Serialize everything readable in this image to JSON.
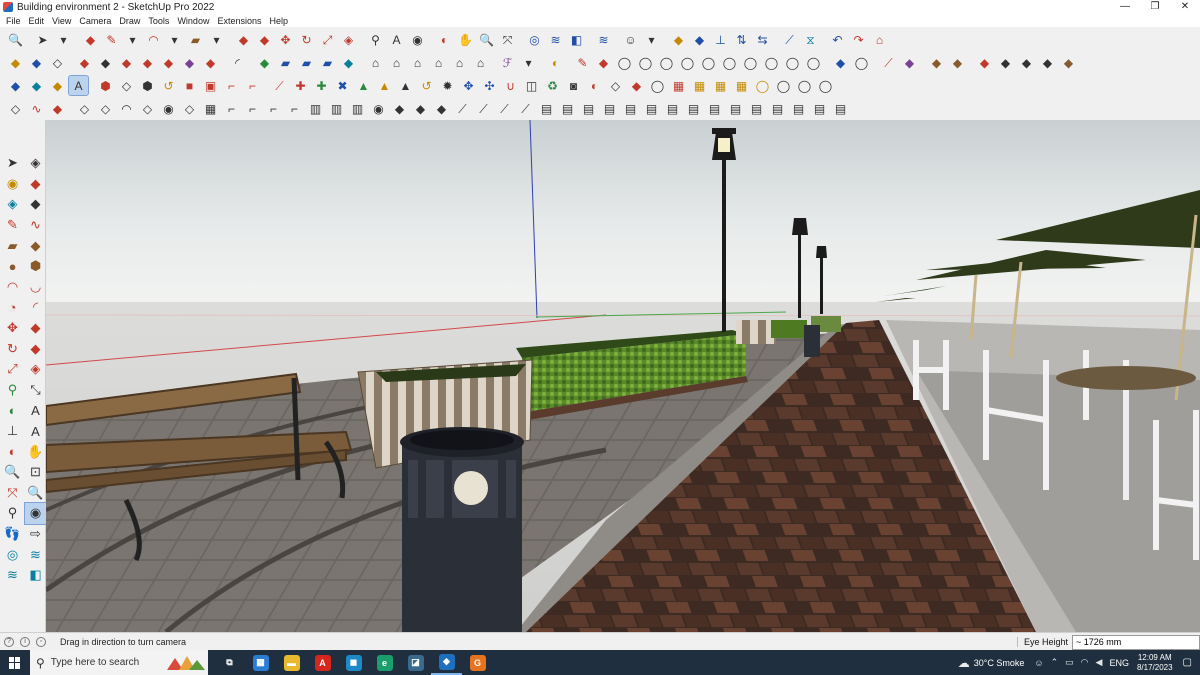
{
  "window": {
    "title": "Building environment 2 - SketchUp Pro 2022",
    "controls": [
      "—",
      "❐",
      "✕"
    ]
  },
  "menu": [
    "File",
    "Edit",
    "View",
    "Camera",
    "Draw",
    "Tools",
    "Window",
    "Extensions",
    "Help"
  ],
  "toolbars": {
    "row1": [
      {
        "icon": "zoom-icon",
        "g": "🔍",
        "c": "c3"
      },
      {
        "icon": "select-icon",
        "g": "➤",
        "c": "c3",
        "sep": true
      },
      {
        "icon": "dropdown-icon",
        "g": "▾",
        "c": "c3"
      },
      {
        "icon": "eraser-icon",
        "g": "◆",
        "c": "c1",
        "sep": true
      },
      {
        "icon": "pencil-icon",
        "g": "✎",
        "c": "c1"
      },
      {
        "icon": "dropdown-icon",
        "g": "▾",
        "c": "c3"
      },
      {
        "icon": "arc-icon",
        "g": "◠",
        "c": "c1"
      },
      {
        "icon": "dropdown-icon",
        "g": "▾",
        "c": "c3"
      },
      {
        "icon": "rectangle-icon",
        "g": "▰",
        "c": "c8"
      },
      {
        "icon": "dropdown-icon",
        "g": "▾",
        "c": "c3"
      },
      {
        "icon": "pushpull-icon",
        "g": "◆",
        "c": "c1",
        "sep": true
      },
      {
        "icon": "followme-icon",
        "g": "◆",
        "c": "c1"
      },
      {
        "icon": "move-icon",
        "g": "✥",
        "c": "c1"
      },
      {
        "icon": "rotate-icon",
        "g": "↻",
        "c": "c1"
      },
      {
        "icon": "scale-icon",
        "g": "⤢",
        "c": "c1"
      },
      {
        "icon": "offset-icon",
        "g": "◈",
        "c": "c1"
      },
      {
        "icon": "tape-icon",
        "g": "⚲",
        "c": "c3",
        "sep": true
      },
      {
        "icon": "text-icon",
        "g": "A",
        "c": "c3"
      },
      {
        "icon": "paint-icon",
        "g": "◉",
        "c": "c3"
      },
      {
        "icon": "orbit-icon",
        "g": "◐",
        "c": "c1",
        "sep": true
      },
      {
        "icon": "pan-icon",
        "g": "✋",
        "c": "c3"
      },
      {
        "icon": "zoom-icon",
        "g": "🔍",
        "c": "c3"
      },
      {
        "icon": "zoom-extents-icon",
        "g": "⤧",
        "c": "c3"
      },
      {
        "icon": "warehouse-icon",
        "g": "◎",
        "c": "c2",
        "sep": true
      },
      {
        "icon": "extension-warehouse-icon",
        "g": "≋",
        "c": "c2"
      },
      {
        "icon": "layout-icon",
        "g": "◧",
        "c": "c2"
      },
      {
        "icon": "style-icon",
        "g": "≋",
        "c": "c2",
        "sep": true
      },
      {
        "icon": "account-icon",
        "g": "☺",
        "c": "c3",
        "sep": true
      },
      {
        "icon": "dropdown-icon",
        "g": "▾",
        "c": "c3"
      },
      {
        "icon": "section-icon",
        "g": "◆",
        "c": "c5",
        "sep": true
      },
      {
        "icon": "section-fill-icon",
        "g": "◆",
        "c": "c2"
      },
      {
        "icon": "axes-icon",
        "g": "⊥",
        "c": "c2"
      },
      {
        "icon": "flip-icon",
        "g": "⇅",
        "c": "c2"
      },
      {
        "icon": "mirror-icon",
        "g": "⇆",
        "c": "c2"
      },
      {
        "icon": "line-tool-icon",
        "g": "⟋",
        "c": "c2",
        "sep": true
      },
      {
        "icon": "triangle-icon",
        "g": "⧖",
        "c": "c7"
      },
      {
        "icon": "undo-icon",
        "g": "↶",
        "c": "c2",
        "sep": true
      },
      {
        "icon": "redo-icon",
        "g": "↷",
        "c": "c1"
      },
      {
        "icon": "plugin-icon",
        "g": "⌂",
        "c": "c1"
      }
    ],
    "row2": [
      {
        "icon": "box-icon",
        "g": "◆",
        "c": "c5"
      },
      {
        "icon": "cube-icon",
        "g": "◆",
        "c": "c2"
      },
      {
        "icon": "wire-icon",
        "g": "◇",
        "c": "c3"
      },
      {
        "icon": "solid-icon",
        "g": "◆",
        "c": "c1",
        "sep": true
      },
      {
        "icon": "shape-icon",
        "g": "◆",
        "c": "c3"
      },
      {
        "icon": "shape2-icon",
        "g": "◆",
        "c": "c1"
      },
      {
        "icon": "shape3-icon",
        "g": "◆",
        "c": "c1"
      },
      {
        "icon": "shape4-icon",
        "g": "◆",
        "c": "c1"
      },
      {
        "icon": "shape5-icon",
        "g": "◆",
        "c": "c6"
      },
      {
        "icon": "shape6-icon",
        "g": "◆",
        "c": "c1"
      },
      {
        "icon": "curve-icon",
        "g": "◜",
        "c": "c3",
        "sep": true
      },
      {
        "icon": "plane-icon",
        "g": "◆",
        "c": "c4",
        "sep": true
      },
      {
        "icon": "plane2-icon",
        "g": "▰",
        "c": "c2"
      },
      {
        "icon": "plane3-icon",
        "g": "▰",
        "c": "c2"
      },
      {
        "icon": "plane4-icon",
        "g": "▰",
        "c": "c2"
      },
      {
        "icon": "plane5-icon",
        "g": "◆",
        "c": "c7"
      },
      {
        "icon": "house-icon",
        "g": "⌂",
        "c": "c3",
        "sep": true
      },
      {
        "icon": "house2-icon",
        "g": "⌂",
        "c": "c3"
      },
      {
        "icon": "house3-icon",
        "g": "⌂",
        "c": "c3"
      },
      {
        "icon": "house4-icon",
        "g": "⌂",
        "c": "c3"
      },
      {
        "icon": "house5-icon",
        "g": "⌂",
        "c": "c3"
      },
      {
        "icon": "house6-icon",
        "g": "⌂",
        "c": "c3"
      },
      {
        "icon": "script-icon",
        "g": "ℱ",
        "c": "c6",
        "sep": true
      },
      {
        "icon": "script2-icon",
        "g": "▾",
        "c": "c3"
      },
      {
        "icon": "smoothie-icon",
        "g": "◐",
        "c": "c5",
        "sep": true
      },
      {
        "icon": "brush-icon",
        "g": "✎",
        "c": "c1",
        "sep": true
      },
      {
        "icon": "tag-icon",
        "g": "◆",
        "c": "c1"
      },
      {
        "icon": "loop-icon",
        "g": "◯",
        "c": "c3"
      },
      {
        "icon": "loop2-icon",
        "g": "◯",
        "c": "c3"
      },
      {
        "icon": "loop3-icon",
        "g": "◯",
        "c": "c3"
      },
      {
        "icon": "loop4-icon",
        "g": "◯",
        "c": "c3"
      },
      {
        "icon": "loop5-icon",
        "g": "◯",
        "c": "c3"
      },
      {
        "icon": "loop6-icon",
        "g": "◯",
        "c": "c3"
      },
      {
        "icon": "loop7-icon",
        "g": "◯",
        "c": "c3"
      },
      {
        "icon": "loop8-icon",
        "g": "◯",
        "c": "c3"
      },
      {
        "icon": "loop9-icon",
        "g": "◯",
        "c": "c3"
      },
      {
        "icon": "loop10-icon",
        "g": "◯",
        "c": "c3"
      },
      {
        "icon": "crease-icon",
        "g": "◆",
        "c": "c2",
        "sep": true
      },
      {
        "icon": "crease2-icon",
        "g": "◯",
        "c": "c3"
      },
      {
        "icon": "knife-icon",
        "g": "⟋",
        "c": "c1",
        "sep": true
      },
      {
        "icon": "eraser2-icon",
        "g": "◆",
        "c": "c6"
      },
      {
        "icon": "layer-icon",
        "g": "◆",
        "c": "c8",
        "sep": true
      },
      {
        "icon": "layer2-icon",
        "g": "◆",
        "c": "c8"
      },
      {
        "icon": "layer3-icon",
        "g": "◆",
        "c": "c1",
        "sep": true
      },
      {
        "icon": "layer4-icon",
        "g": "◆",
        "c": "c3"
      },
      {
        "icon": "layer5-icon",
        "g": "◆",
        "c": "c3"
      },
      {
        "icon": "layer6-icon",
        "g": "◆",
        "c": "c3"
      },
      {
        "icon": "layer7-icon",
        "g": "◆",
        "c": "c8"
      }
    ],
    "row3": [
      {
        "icon": "joint-icon",
        "g": "◆",
        "c": "c2"
      },
      {
        "icon": "joint2-icon",
        "g": "◆",
        "c": "c7"
      },
      {
        "icon": "joint3-icon",
        "g": "◆",
        "c": "c5"
      },
      {
        "icon": "joint4-icon",
        "g": "A",
        "c": "c3",
        "active": true
      },
      {
        "icon": "gem-icon",
        "g": "⬢",
        "c": "c1",
        "sep": true
      },
      {
        "icon": "profile-icon",
        "g": "◇",
        "c": "c3"
      },
      {
        "icon": "nut-icon",
        "g": "⬢",
        "c": "c3"
      },
      {
        "icon": "hook-icon",
        "g": "↺",
        "c": "c5"
      },
      {
        "icon": "stop-icon",
        "g": "■",
        "c": "c1"
      },
      {
        "icon": "frame-icon",
        "g": "▣",
        "c": "c1"
      },
      {
        "icon": "pipe-icon",
        "g": "⌐",
        "c": "c1"
      },
      {
        "icon": "pipe2-icon",
        "g": "⌐",
        "c": "c1"
      },
      {
        "icon": "spline-icon",
        "g": "⟋",
        "c": "c1",
        "sep": true
      },
      {
        "icon": "plus-icon",
        "g": "✚",
        "c": "c1"
      },
      {
        "icon": "plus2-icon",
        "g": "✚",
        "c": "c4"
      },
      {
        "icon": "cross-icon",
        "g": "✖",
        "c": "c2"
      },
      {
        "icon": "tri-icon",
        "g": "▲",
        "c": "c4"
      },
      {
        "icon": "tri2-icon",
        "g": "▲",
        "c": "c5"
      },
      {
        "icon": "tri3-icon",
        "g": "▲",
        "c": "c3"
      },
      {
        "icon": "curl-icon",
        "g": "↺",
        "c": "c5"
      },
      {
        "icon": "gear-icon",
        "g": "✹",
        "c": "c3"
      },
      {
        "icon": "star-icon",
        "g": "✥",
        "c": "c2"
      },
      {
        "icon": "star2-icon",
        "g": "✣",
        "c": "c2"
      },
      {
        "icon": "magnet-icon",
        "g": "∪",
        "c": "c1"
      },
      {
        "icon": "bend-icon",
        "g": "◫",
        "c": "c3"
      },
      {
        "icon": "twist-icon",
        "g": "♻",
        "c": "c4"
      },
      {
        "icon": "shell-icon",
        "g": "◙",
        "c": "c3"
      },
      {
        "icon": "split-icon",
        "g": "◐",
        "c": "c1"
      },
      {
        "icon": "bevel-icon",
        "g": "◇",
        "c": "c3"
      },
      {
        "icon": "chamfer-icon",
        "g": "◆",
        "c": "c1"
      },
      {
        "icon": "round-icon",
        "g": "◯",
        "c": "c3"
      },
      {
        "icon": "tile-icon",
        "g": "▦",
        "c": "c1"
      },
      {
        "icon": "tile2-icon",
        "g": "▦",
        "c": "c5"
      },
      {
        "icon": "tile3-icon",
        "g": "▦",
        "c": "c5"
      },
      {
        "icon": "tile4-icon",
        "g": "▦",
        "c": "c5"
      },
      {
        "icon": "ring-icon",
        "g": "◯",
        "c": "c5"
      },
      {
        "icon": "ring2-icon",
        "g": "◯",
        "c": "c3"
      },
      {
        "icon": "ring3-icon",
        "g": "◯",
        "c": "c3"
      },
      {
        "icon": "ring4-icon",
        "g": "◯",
        "c": "c3"
      }
    ],
    "row4": [
      {
        "icon": "explode-icon",
        "g": "◇",
        "c": "c3"
      },
      {
        "icon": "wave-icon",
        "g": "∿",
        "c": "c1"
      },
      {
        "icon": "fill-icon",
        "g": "◆",
        "c": "c1"
      },
      {
        "icon": "box2-icon",
        "g": "◇",
        "c": "c3",
        "sep": true
      },
      {
        "icon": "box3-icon",
        "g": "◇",
        "c": "c3"
      },
      {
        "icon": "arch-icon",
        "g": "◠",
        "c": "c3"
      },
      {
        "icon": "box4-icon",
        "g": "◇",
        "c": "c3"
      },
      {
        "icon": "ball-icon",
        "g": "◉",
        "c": "c3"
      },
      {
        "icon": "box5-icon",
        "g": "◇",
        "c": "c3"
      },
      {
        "icon": "grid-icon",
        "g": "▦",
        "c": "c3"
      },
      {
        "icon": "elbow-icon",
        "g": "⌐",
        "c": "c3"
      },
      {
        "icon": "elbow2-icon",
        "g": "⌐",
        "c": "c3"
      },
      {
        "icon": "elbow3-icon",
        "g": "⌐",
        "c": "c3"
      },
      {
        "icon": "elbow4-icon",
        "g": "⌐",
        "c": "c3"
      },
      {
        "icon": "stairs-icon",
        "g": "▥",
        "c": "c3"
      },
      {
        "icon": "fence-icon",
        "g": "▥",
        "c": "c3"
      },
      {
        "icon": "fence2-icon",
        "g": "▥",
        "c": "c3"
      },
      {
        "icon": "globe-icon",
        "g": "◉",
        "c": "c3"
      },
      {
        "icon": "roof-icon",
        "g": "◆",
        "c": "c3"
      },
      {
        "icon": "roof2-icon",
        "g": "◆",
        "c": "c3"
      },
      {
        "icon": "roof3-icon",
        "g": "◆",
        "c": "c3"
      },
      {
        "icon": "slope-icon",
        "g": "⟋",
        "c": "c3"
      },
      {
        "icon": "slope2-icon",
        "g": "⟋",
        "c": "c3"
      },
      {
        "icon": "slope3-icon",
        "g": "⟋",
        "c": "c3"
      },
      {
        "icon": "slope4-icon",
        "g": "⟋",
        "c": "c3"
      },
      {
        "icon": "hatch-icon",
        "g": "▤",
        "c": "c3"
      },
      {
        "icon": "hatch2-icon",
        "g": "▤",
        "c": "c3"
      },
      {
        "icon": "hatch3-icon",
        "g": "▤",
        "c": "c3"
      },
      {
        "icon": "hatch4-icon",
        "g": "▤",
        "c": "c3"
      },
      {
        "icon": "hatch5-icon",
        "g": "▤",
        "c": "c3"
      },
      {
        "icon": "hatch6-icon",
        "g": "▤",
        "c": "c3"
      },
      {
        "icon": "hatch7-icon",
        "g": "▤",
        "c": "c3"
      },
      {
        "icon": "hatch8-icon",
        "g": "▤",
        "c": "c3"
      },
      {
        "icon": "hatch9-icon",
        "g": "▤",
        "c": "c3"
      },
      {
        "icon": "hatch10-icon",
        "g": "▤",
        "c": "c3"
      },
      {
        "icon": "hatch11-icon",
        "g": "▤",
        "c": "c3"
      },
      {
        "icon": "hatch12-icon",
        "g": "▤",
        "c": "c3"
      },
      {
        "icon": "hatch13-icon",
        "g": "▤",
        "c": "c3"
      },
      {
        "icon": "hatch14-icon",
        "g": "▤",
        "c": "c3"
      },
      {
        "icon": "hatch15-icon",
        "g": "▤",
        "c": "c3"
      }
    ]
  },
  "left_tools": [
    {
      "icon": "select-icon",
      "g": "➤",
      "c": "c3"
    },
    {
      "icon": "component-icon",
      "g": "◈",
      "c": "c3"
    },
    {
      "icon": "paint-bucket-icon",
      "g": "◉",
      "c": "c5"
    },
    {
      "icon": "eraser-icon",
      "g": "◆",
      "c": "c1"
    },
    {
      "icon": "make-component-icon",
      "g": "◈",
      "c": "c7"
    },
    {
      "icon": "tag-tool-icon",
      "g": "◆",
      "c": "c3"
    },
    {
      "icon": "line-icon",
      "g": "✎",
      "c": "c1"
    },
    {
      "icon": "freehand-icon",
      "g": "∿",
      "c": "c1"
    },
    {
      "icon": "rectangle-icon",
      "g": "▰",
      "c": "c8"
    },
    {
      "icon": "rotated-rectangle-icon",
      "g": "◆",
      "c": "c8"
    },
    {
      "icon": "circle-icon",
      "g": "●",
      "c": "c8"
    },
    {
      "icon": "polygon-icon",
      "g": "⬢",
      "c": "c8"
    },
    {
      "icon": "arc-icon",
      "g": "◠",
      "c": "c1"
    },
    {
      "icon": "arc2-icon",
      "g": "◡",
      "c": "c1"
    },
    {
      "icon": "pie-icon",
      "g": "◔",
      "c": "c1"
    },
    {
      "icon": "arc3-icon",
      "g": "◜",
      "c": "c1"
    },
    {
      "icon": "move-icon",
      "g": "✥",
      "c": "c1"
    },
    {
      "icon": "pushpull-icon",
      "g": "◆",
      "c": "c1"
    },
    {
      "icon": "rotate-icon",
      "g": "↻",
      "c": "c1"
    },
    {
      "icon": "followme-icon",
      "g": "◆",
      "c": "c1"
    },
    {
      "icon": "scale-icon",
      "g": "⤢",
      "c": "c1"
    },
    {
      "icon": "offset-icon",
      "g": "◈",
      "c": "c1"
    },
    {
      "icon": "tape-measure-icon",
      "g": "⚲",
      "c": "c4"
    },
    {
      "icon": "dimension-icon",
      "g": "⤡",
      "c": "c3"
    },
    {
      "icon": "protractor-icon",
      "g": "◐",
      "c": "c4"
    },
    {
      "icon": "text-icon",
      "g": "A",
      "c": "c3"
    },
    {
      "icon": "axes-icon",
      "g": "⊥",
      "c": "c3"
    },
    {
      "icon": "3d-text-icon",
      "g": "A",
      "c": "c3"
    },
    {
      "icon": "orbit-icon",
      "g": "◐",
      "c": "c1"
    },
    {
      "icon": "pan-icon",
      "g": "✋",
      "c": "c5"
    },
    {
      "icon": "zoom-icon",
      "g": "🔍",
      "c": "c3"
    },
    {
      "icon": "zoom-window-icon",
      "g": "⊡",
      "c": "c3"
    },
    {
      "icon": "zoom-extents-icon",
      "g": "⤧",
      "c": "c1"
    },
    {
      "icon": "previous-view-icon",
      "g": "🔍",
      "c": "c3"
    },
    {
      "icon": "position-camera-icon",
      "g": "⚲",
      "c": "c3"
    },
    {
      "icon": "look-around-icon",
      "g": "◉",
      "c": "c3",
      "active": true
    },
    {
      "icon": "walk-icon",
      "g": "👣",
      "c": "c3"
    },
    {
      "icon": "section-plane-icon",
      "g": "⇨",
      "c": "c3"
    },
    {
      "icon": "warehouse-icon",
      "g": "◎",
      "c": "c7"
    },
    {
      "icon": "extension-icon",
      "g": "≋",
      "c": "c7"
    },
    {
      "icon": "layout-icon",
      "g": "≋",
      "c": "c7"
    },
    {
      "icon": "style-builder-icon",
      "g": "◧",
      "c": "c7"
    }
  ],
  "status": {
    "hint": "Drag in direction to turn camera",
    "vcb_label": "Eye Height",
    "vcb_value": "~ 1726 mm"
  },
  "taskbar": {
    "search_placeholder": "Type here to search",
    "apps": [
      {
        "icon": "task-view-icon",
        "g": "⧉",
        "bg": "transparent"
      },
      {
        "icon": "calculator-icon",
        "g": "▦",
        "bg": "#2b7cd3"
      },
      {
        "icon": "file-explorer-icon",
        "g": "▬",
        "bg": "#e8b82e"
      },
      {
        "icon": "acrobat-icon",
        "g": "A",
        "bg": "#d7261e"
      },
      {
        "icon": "store-icon",
        "g": "◼",
        "bg": "#1e88c8"
      },
      {
        "icon": "edge-icon",
        "g": "e",
        "bg": "#1a9e6b"
      },
      {
        "icon": "image-viewer-icon",
        "g": "◪",
        "bg": "#3a6b8f"
      },
      {
        "icon": "sketchup-icon",
        "g": "◆",
        "bg": "#1f6fbf",
        "on": true
      },
      {
        "icon": "orange-app-icon",
        "g": "G",
        "bg": "#e8731e"
      }
    ],
    "weather": "30°C  Smoke",
    "lang": "ENG",
    "time": "12:09 AM",
    "date": "8/17/2023"
  }
}
